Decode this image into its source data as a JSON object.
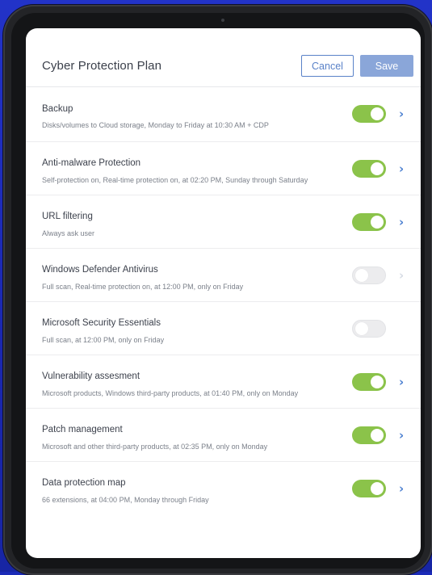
{
  "header": {
    "title": "Cyber Protection Plan",
    "cancel_label": "Cancel",
    "save_label": "Save"
  },
  "colors": {
    "toggle_on": "#8bc34a",
    "toggle_off": "#ececee",
    "accent": "#5a82c8",
    "save_button": "#8aa6d9",
    "background": "#1b2bb8"
  },
  "items": [
    {
      "title": "Backup",
      "description": "Disks/volumes to Cloud storage, Monday to Friday at 10:30 AM + CDP",
      "enabled": true,
      "chevron": "chevron-right-icon"
    },
    {
      "title": "Anti-malware Protection",
      "description": "Self-protection on, Real-time protection on, at 02:20 PM, Sunday through Saturday",
      "enabled": true,
      "chevron": "chevron-right-icon"
    },
    {
      "title": "URL filtering",
      "description": "Always ask user",
      "enabled": true,
      "chevron": "chevron-right-icon"
    },
    {
      "title": "Windows Defender Antivirus",
      "description": "Full scan, Real-time protection on, at 12:00 PM, only on Friday",
      "enabled": false,
      "chevron": "chevron-right-icon"
    },
    {
      "title": "Microsoft Security Essentials",
      "description": "Full scan, at 12:00 PM, only on Friday",
      "enabled": false,
      "chevron": null
    },
    {
      "title": "Vulnerability assesment",
      "description": "Microsoft products, Windows third-party products, at 01:40 PM, only on Monday",
      "enabled": true,
      "chevron": "chevron-right-icon"
    },
    {
      "title": "Patch management",
      "description": "Microsoft and other third-party products, at 02:35 PM, only on Monday",
      "enabled": true,
      "chevron": "chevron-right-icon"
    },
    {
      "title": "Data protection map",
      "description": "66 extensions, at 04:00 PM, Monday through Friday",
      "enabled": true,
      "chevron": "chevron-right-icon"
    }
  ]
}
